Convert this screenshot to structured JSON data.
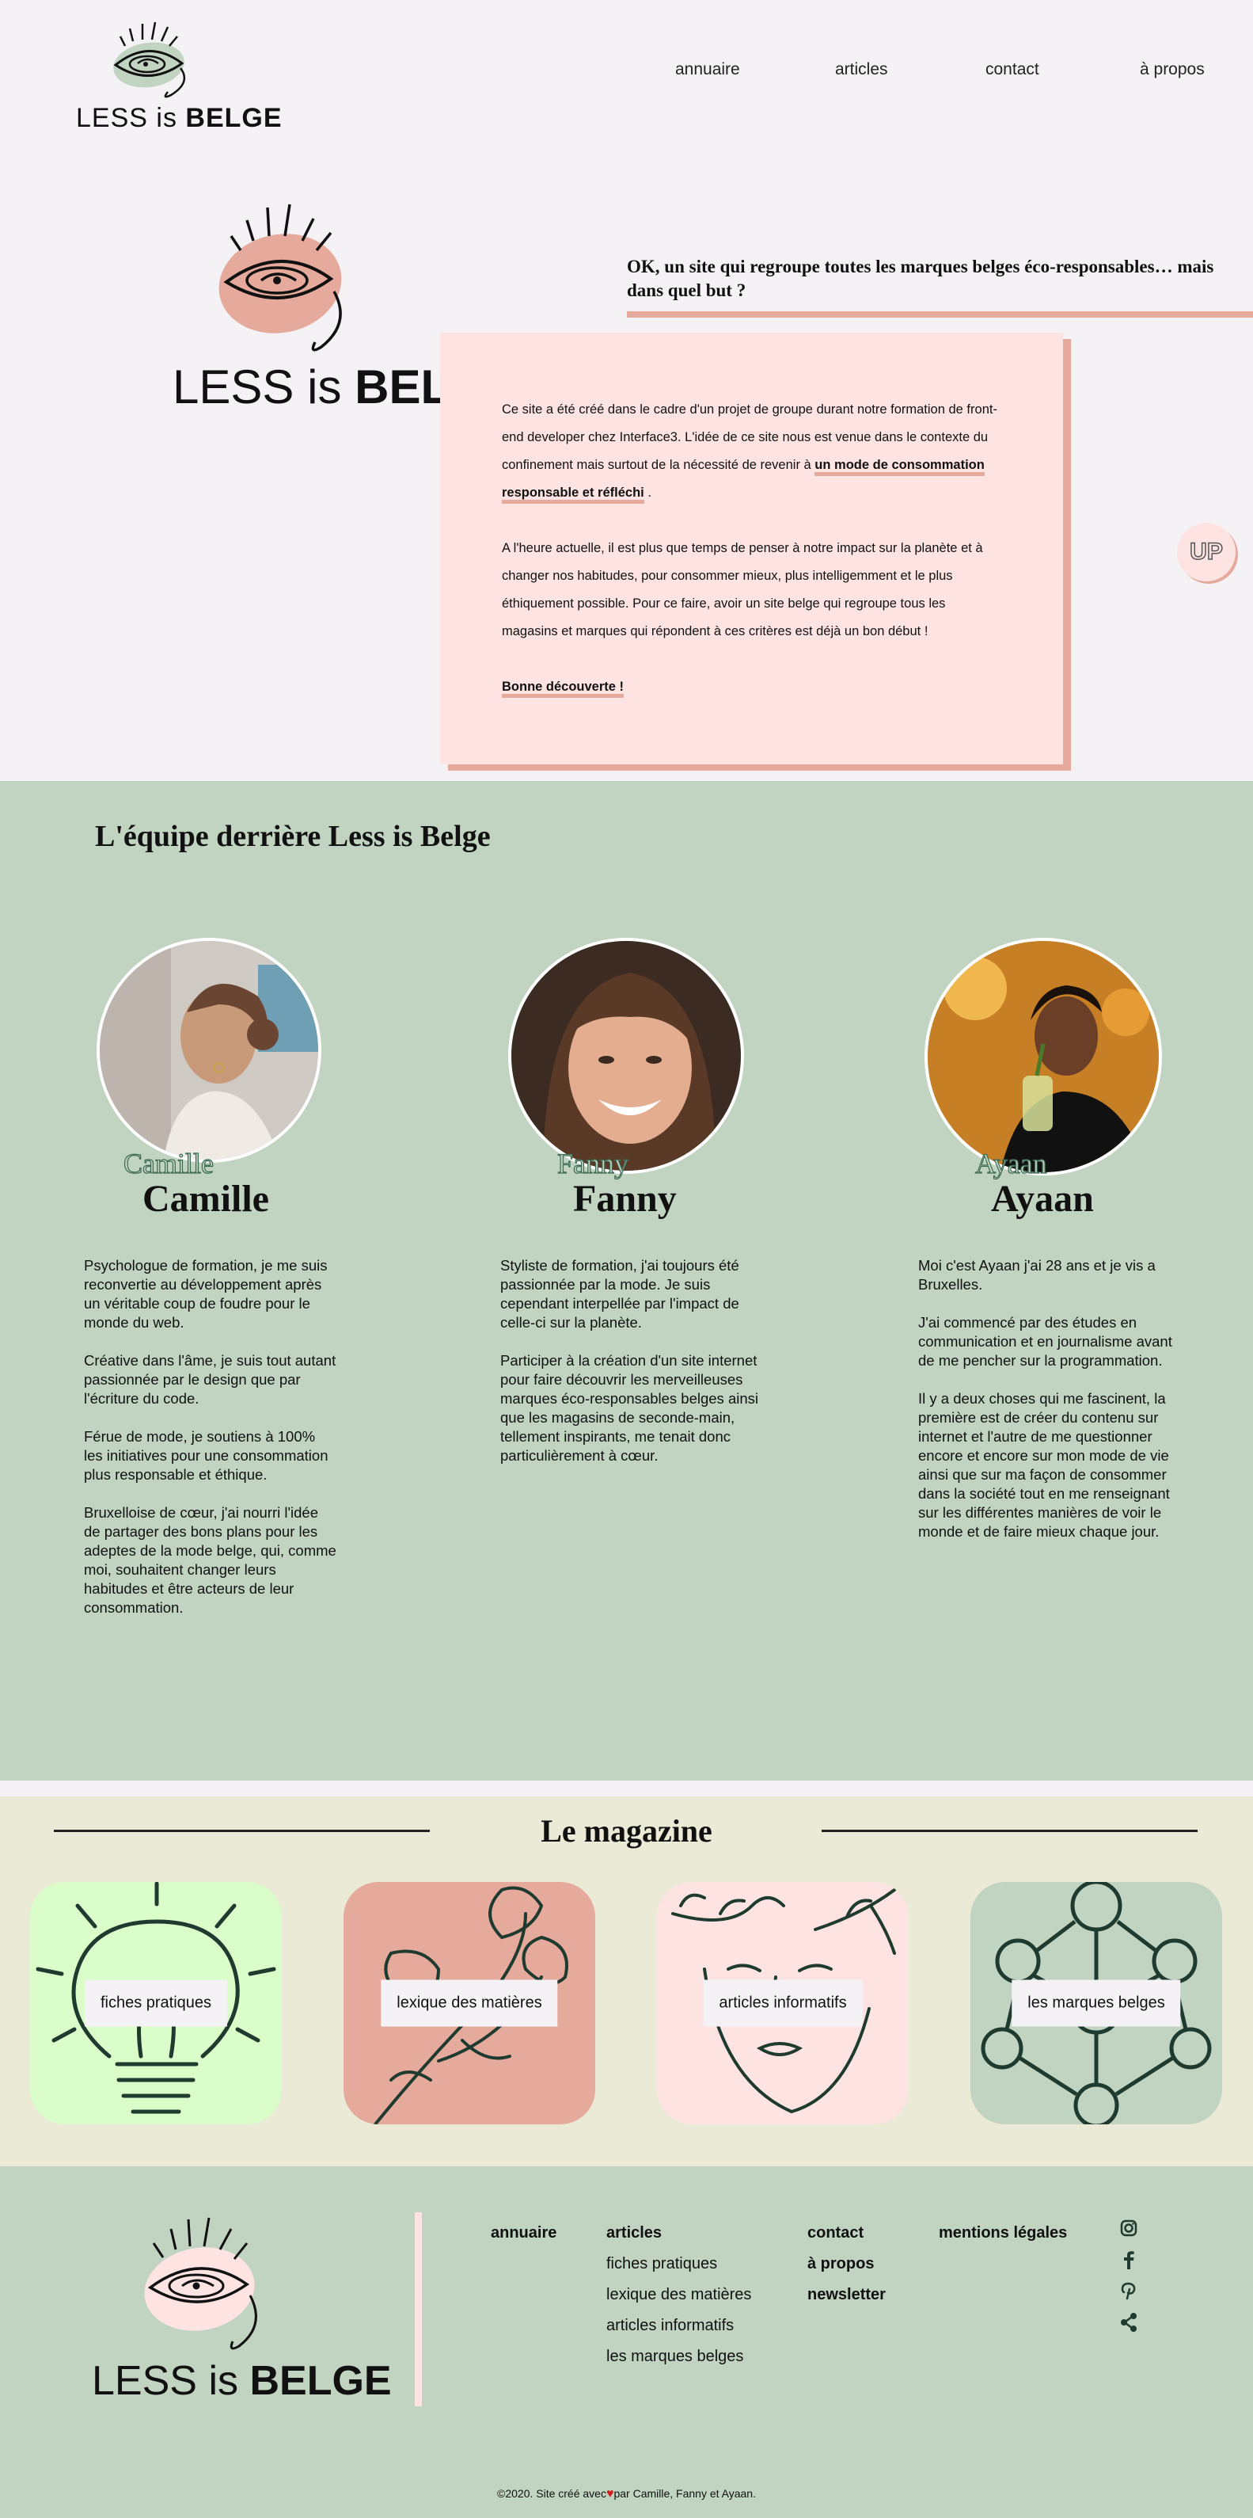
{
  "brand": {
    "less": "LESS",
    "is": "is",
    "belge": "BELGE"
  },
  "nav": {
    "annuaire": "annuaire",
    "articles": "articles",
    "contact": "contact",
    "a_propos": "à propos"
  },
  "intro": {
    "question": "OK, un site qui regroupe toutes les marques belges éco-responsables… mais dans quel but ?",
    "p1_a": "Ce site a été créé dans le cadre d'un projet de groupe durant notre formation de front-end developer chez Interface3. L'idée de ce site nous est venue dans le contexte du confinement mais surtout de la nécessité de revenir à ",
    "p1_hl": "un mode de consommation responsable et réfléchi",
    "p1_end": " .",
    "p2": "A l'heure actuelle, il est plus que temps de penser à notre impact sur la planète et à changer nos habitudes, pour consommer mieux, plus intelligemment et le plus éthiquement possible. Pour ce faire, avoir un site belge qui regroupe tous les magasins et marques qui répondent à ces critères est déjà un bon début !",
    "closing": "Bonne découverte !"
  },
  "up_button": "UP",
  "team": {
    "title": "L'équipe derrière Less is Belge",
    "members": [
      {
        "ghost": "Camille",
        "name": "Camille",
        "bio": [
          "Psychologue de formation, je me suis reconvertie au développement après un véritable coup de foudre pour le monde du web.",
          "Créative dans l'âme, je suis tout autant passionnée par le design que par l'écriture du code.",
          "Férue de mode, je soutiens à 100% les initiatives pour une consommation plus responsable et éthique.",
          "Bruxelloise de cœur, j'ai nourri l'idée de partager des bons plans pour les adeptes de la mode belge, qui, comme moi, souhaitent changer leurs habitudes et être acteurs de leur consommation."
        ]
      },
      {
        "ghost": "Fanny",
        "name": "Fanny",
        "bio": [
          "Styliste de formation, j'ai toujours été passionnée par la mode. Je suis cependant interpellée par l'impact de celle-ci sur la planète.",
          "Participer à la création d'un site internet pour faire découvrir les merveilleuses marques éco-responsables belges ainsi que les magasins de seconde-main, tellement inspirants, me tenait donc particulièrement à cœur."
        ]
      },
      {
        "ghost": "Ayaan",
        "name": "Ayaan",
        "bio": [
          "Moi c'est Ayaan j'ai 28 ans et je vis a Bruxelles.",
          "J'ai commencé par des études en communication et en journalisme avant de me pencher sur la programmation.",
          "Il y a deux choses qui me fascinent, la première est de créer du contenu sur internet et l'autre de me questionner encore et encore sur mon mode de vie ainsi que sur ma façon de consommer dans la société tout en me renseignant sur les différentes manières de voir le monde et de faire mieux chaque jour."
        ]
      }
    ]
  },
  "magazine": {
    "title": "Le magazine",
    "cards": [
      {
        "label": "fiches pratiques",
        "color": "#dafdc9"
      },
      {
        "label": "lexique des matières",
        "color": "#e5aa9c"
      },
      {
        "label": "articles informatifs",
        "color": "#fde4e3"
      },
      {
        "label": "les marques belges",
        "color": "#c1d3c1"
      }
    ]
  },
  "footer": {
    "annuaire": "annuaire",
    "articles": "articles",
    "articles_items": [
      "fiches pratiques",
      "lexique des matières",
      "articles informatifs",
      "les marques belges"
    ],
    "contact": "contact",
    "a_propos": "à propos",
    "newsletter": "newsletter",
    "mentions": "mentions légales",
    "social_icons": [
      "instagram-icon",
      "facebook-icon",
      "pinterest-icon",
      "share-icon"
    ],
    "copyright_a": "©2020. Site créé avec",
    "copyright_b": "par Camille, Fanny et Ayaan."
  },
  "colors": {
    "pink": "#fde4e3",
    "salmon": "#e5aa9c",
    "sage": "#c1d3c1",
    "lime": "#dafdc9",
    "cream": "#ebead6",
    "ink": "#1f3a2e"
  }
}
